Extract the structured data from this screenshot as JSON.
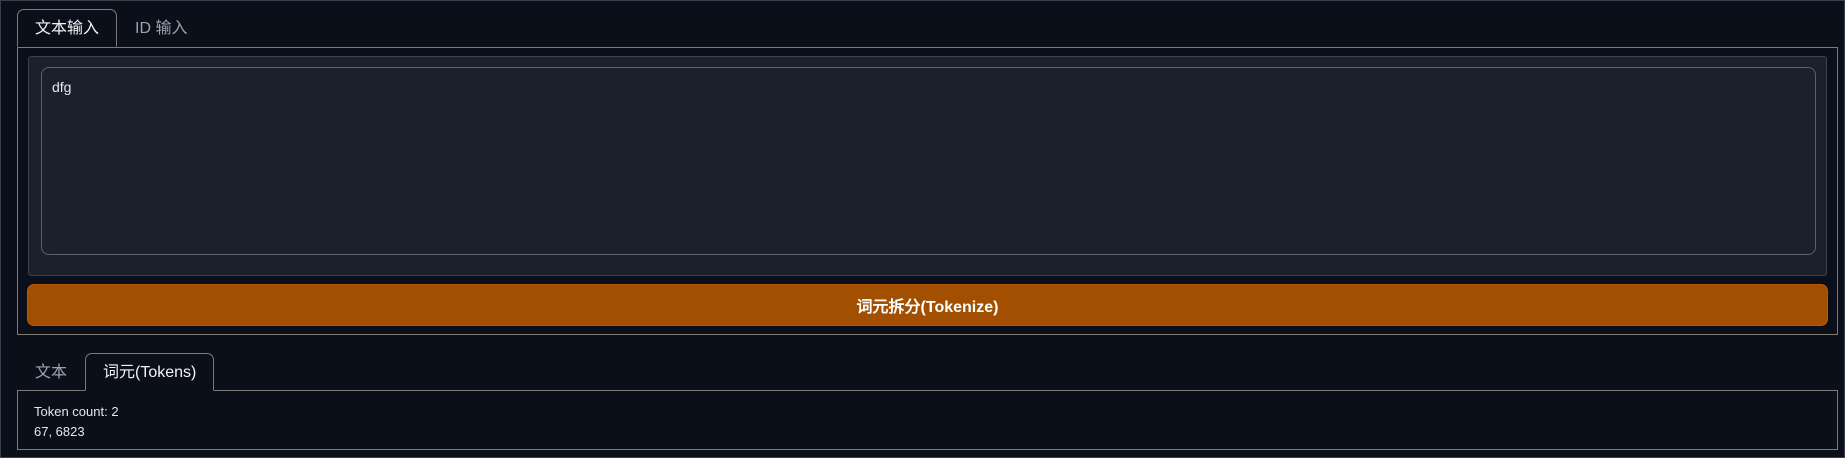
{
  "input_tabs": [
    {
      "label": "文本输入",
      "active": true
    },
    {
      "label": "ID 输入",
      "active": false
    }
  ],
  "textbox": {
    "value": "dfg"
  },
  "tokenize_button": {
    "label": "词元拆分(Tokenize)",
    "color": "#a34f01"
  },
  "output_tabs": [
    {
      "label": "文本",
      "active": false
    },
    {
      "label": "词元(Tokens)",
      "active": true
    }
  ],
  "output": {
    "token_count_line": "Token count: 2",
    "token_ids": "67, 6823"
  }
}
